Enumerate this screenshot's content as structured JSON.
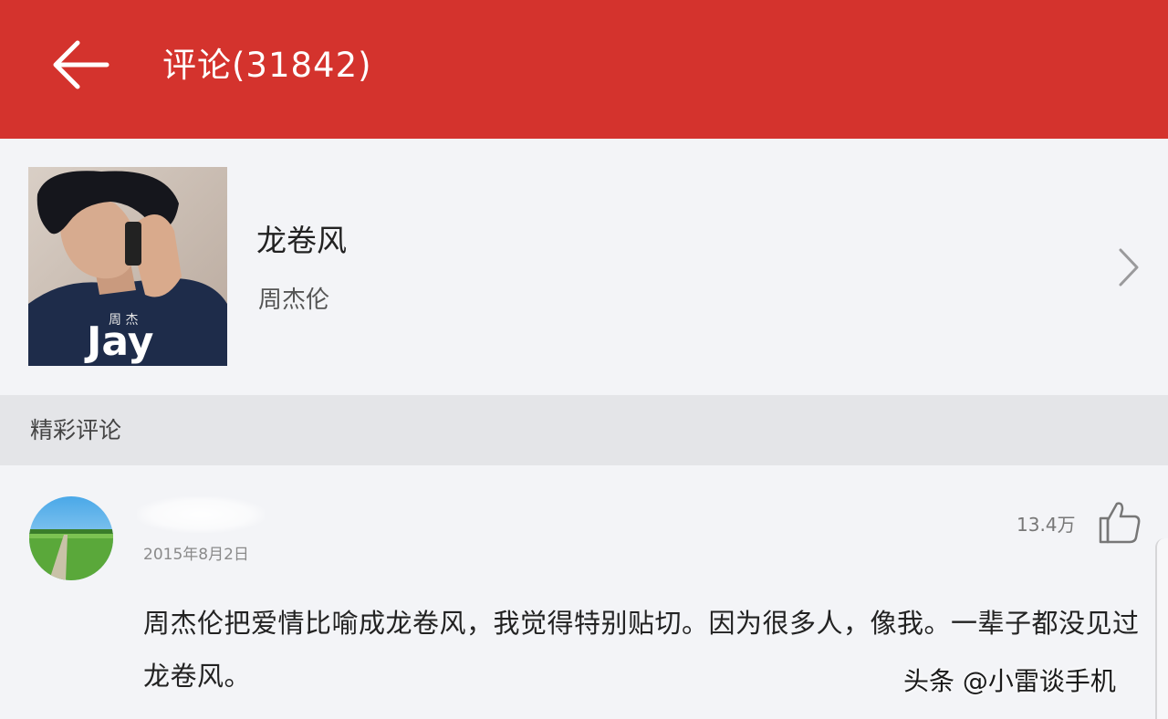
{
  "header": {
    "back_icon": "arrow-left-icon",
    "title": "评论(31842)",
    "background_color": "#d4332d"
  },
  "song": {
    "title": "龙卷风",
    "artist": "周杰伦",
    "cover_text": "Jay",
    "chevron_icon": "chevron-right-icon"
  },
  "section": {
    "title": "精彩评论"
  },
  "comment": {
    "date": "2015年8月2日",
    "likes": "13.4万",
    "like_icon": "thumbs-up-icon",
    "text": "周杰伦把爱情比喻成龙卷风，我觉得特别贴切。因为很多人，像我。一辈子都没见过龙卷风。"
  },
  "watermark": "头条 @小雷谈手机"
}
